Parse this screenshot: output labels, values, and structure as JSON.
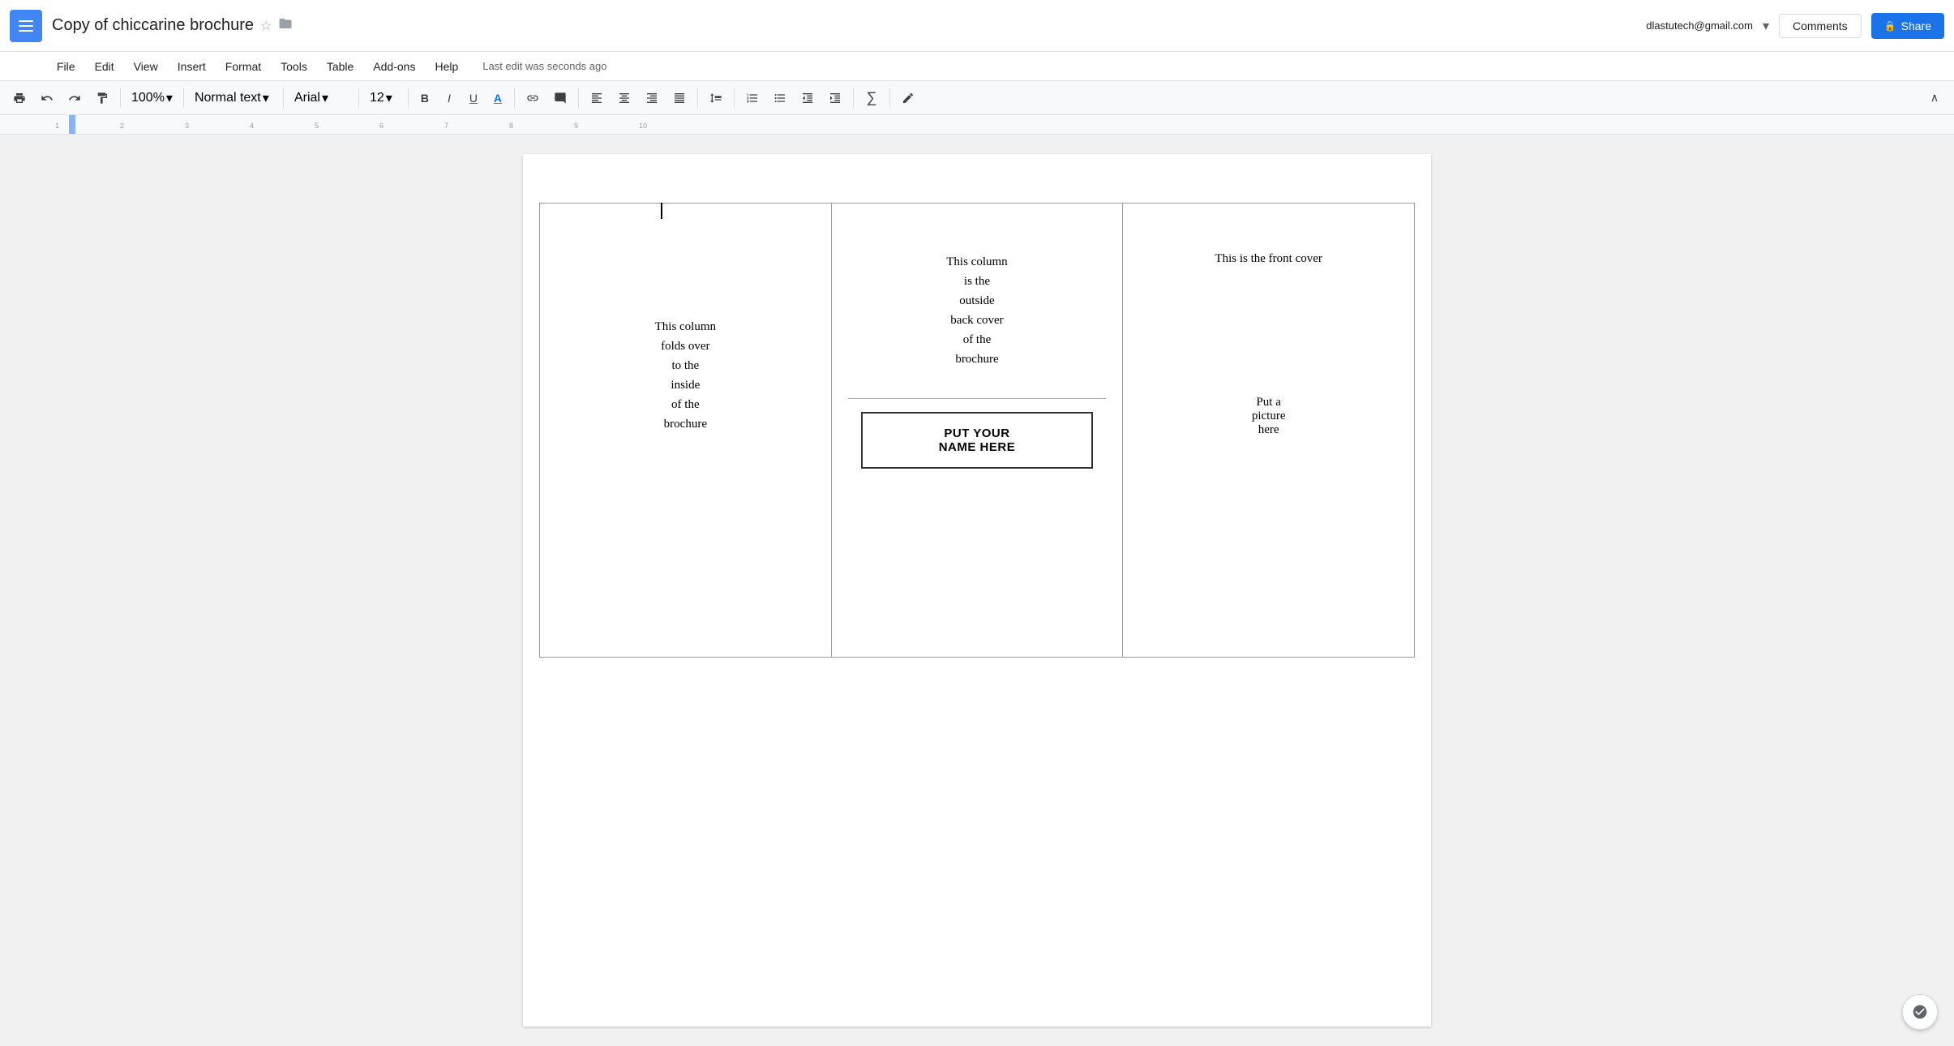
{
  "app": {
    "menu_icon_label": "☰",
    "doc_title": "Copy of chiccarine brochure",
    "star_icon": "☆",
    "folder_icon": "📁",
    "user_email": "dlastutech@gmail.com",
    "dropdown_arrow": "▾",
    "comments_label": "Comments",
    "share_label": "Share",
    "lock_icon": "🔒"
  },
  "menu": {
    "items": [
      "File",
      "Edit",
      "View",
      "Insert",
      "Format",
      "Tools",
      "Table",
      "Add-ons",
      "Help"
    ],
    "last_edit": "Last edit was seconds ago"
  },
  "toolbar": {
    "zoom": "100%",
    "style": "Normal text",
    "font": "Arial",
    "size": "12",
    "bold": "B",
    "italic": "I",
    "underline": "U",
    "color_a": "A",
    "link": "🔗",
    "comment": "💬",
    "align_left": "≡",
    "align_center": "≡",
    "align_right": "≡",
    "align_justify": "≡",
    "line_spacing": "↕",
    "numbered_list": "1.",
    "bullet_list": "•",
    "indent_less": "←",
    "indent_more": "→",
    "formula": "∑",
    "pen": "✏",
    "collapse": "∧"
  },
  "document": {
    "col1": {
      "line1": "This column",
      "line2": "folds over",
      "line3": "to the",
      "line4": "inside",
      "line5": "of the",
      "line6": "brochure"
    },
    "col2": {
      "line1": "This column",
      "line2": "is the",
      "line3": "outside",
      "line4": "back cover",
      "line5": "of the",
      "line6": "brochure",
      "name_box_line1": "PUT YOUR",
      "name_box_line2": "NAME HERE"
    },
    "col3": {
      "front_cover": "This is the front cover",
      "picture_line1": "Put a",
      "picture_line2": "picture",
      "picture_line3": "here"
    }
  }
}
